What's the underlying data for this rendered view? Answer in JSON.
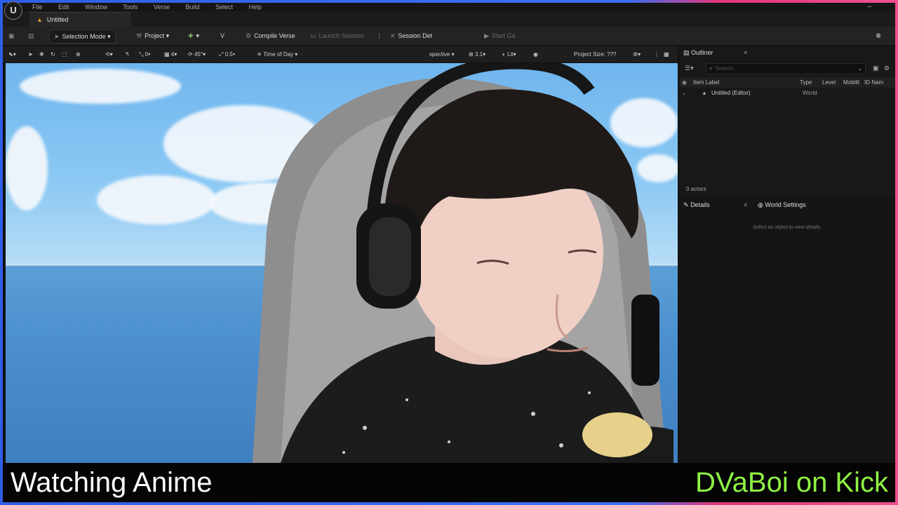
{
  "menu": {
    "items": [
      "File",
      "Edit",
      "Window",
      "Tools",
      "Verse",
      "Build",
      "Select",
      "Help"
    ],
    "logo": "U",
    "window_button": "–"
  },
  "document_tab": {
    "label": "Untitled",
    "icon": "level-icon"
  },
  "toolbar": {
    "selection_mode": "Selection Mode",
    "project": "Project",
    "compile_verse": "Compile Verse",
    "launch_session": "Launch Session",
    "session_details": "Session Det",
    "start_game": "Start Ga"
  },
  "viewport_toolbar": {
    "snap_translate": "0",
    "grid": "4",
    "rotate_snap": "45°",
    "scale_snap": "0.5",
    "time_of_day": "Time of Day",
    "perspective": "spective",
    "camera_speed": "3.1",
    "view_mode": "Lit",
    "project_size": "Project Size: ???"
  },
  "outliner": {
    "title": "Outliner",
    "search_placeholder": "Search...",
    "columns": {
      "label": "Item Label",
      "type": "Type",
      "level": "Level",
      "mobility": "Mobilit",
      "id_name": "ID Nam"
    },
    "rows": [
      {
        "label": "Untitled (Editor)",
        "type": "World"
      }
    ],
    "actor_count": "0 actors"
  },
  "details": {
    "tab_details": "Details",
    "tab_world_settings": "World Settings",
    "hint": "Select an object to view details."
  },
  "overlay": {
    "left_text": "Watching Anime",
    "right_text": "DVaBoi on Kick",
    "right_color": "#8ff243"
  }
}
